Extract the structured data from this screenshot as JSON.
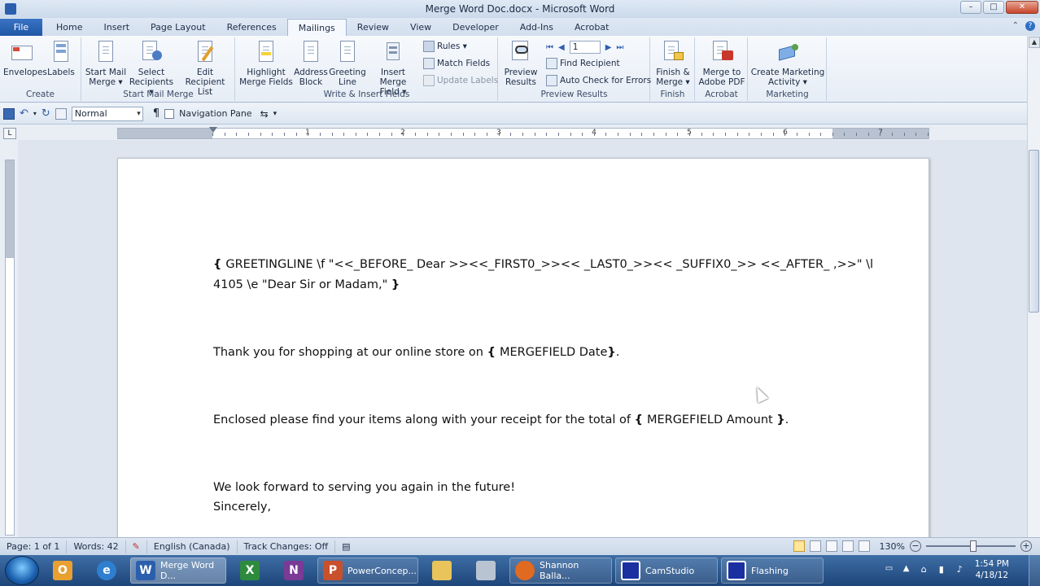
{
  "window": {
    "title": "Merge Word Doc.docx - Microsoft Word",
    "controls": {
      "minimize": "–",
      "maximize": "□",
      "close": "✕"
    }
  },
  "tabs": [
    {
      "label": "File",
      "active": false
    },
    {
      "label": "Home",
      "active": false
    },
    {
      "label": "Insert",
      "active": false
    },
    {
      "label": "Page Layout",
      "active": false
    },
    {
      "label": "References",
      "active": false
    },
    {
      "label": "Mailings",
      "active": true
    },
    {
      "label": "Review",
      "active": false
    },
    {
      "label": "View",
      "active": false
    },
    {
      "label": "Developer",
      "active": false
    },
    {
      "label": "Add-Ins",
      "active": false
    },
    {
      "label": "Acrobat",
      "active": false
    }
  ],
  "ribbon": {
    "create": {
      "label": "Create",
      "envelopes": "Envelopes",
      "labels": "Labels"
    },
    "start_mail_merge": {
      "label": "Start Mail Merge",
      "start_mail_merge_1": "Start Mail",
      "start_mail_merge_2": "Merge ▾",
      "select_recipients_1": "Select",
      "select_recipients_2": "Recipients ▾",
      "edit_recipient_list_1": "Edit",
      "edit_recipient_list_2": "Recipient List"
    },
    "write_insert": {
      "label": "Write & Insert Fields",
      "highlight_1": "Highlight",
      "highlight_2": "Merge Fields",
      "address_1": "Address",
      "address_2": "Block",
      "greeting_1": "Greeting",
      "greeting_2": "Line",
      "insert_merge_1": "Insert Merge",
      "insert_merge_2": "Field ▾",
      "rules": "Rules ▾",
      "match_fields": "Match Fields",
      "update_labels": "Update Labels"
    },
    "preview_results": {
      "label": "Preview Results",
      "preview_1": "Preview",
      "preview_2": "Results",
      "record_number": "1",
      "find_recipient": "Find Recipient",
      "auto_check": "Auto Check for Errors"
    },
    "finish": {
      "label": "Finish",
      "finish_1": "Finish &",
      "finish_2": "Merge ▾"
    },
    "acrobat": {
      "label": "Acrobat",
      "merge_pdf_1": "Merge to",
      "merge_pdf_2": "Adobe PDF"
    },
    "marketing": {
      "label": "Marketing",
      "create_1": "Create Marketing",
      "create_2": "Activity ▾"
    }
  },
  "qat": {
    "style": "Normal",
    "pilcrow": "¶",
    "navigation_pane": "Navigation Pane"
  },
  "ruler": {
    "corner": "L",
    "numbers": [
      "1",
      "2",
      "3",
      "4",
      "5",
      "6",
      "7"
    ]
  },
  "document": {
    "greeting_line_1a": "{ ",
    "greeting_line_1b": "GREETINGLINE \\f \"<<_BEFORE_ Dear >><<_FIRST0_>><< _LAST0_>><< _SUFFIX0_>> <<_AFTER_ ,>>\" \\l",
    "greeting_line_2a": "4105 \\e \"Dear Sir or Madam,\" ",
    "greeting_line_2b": "}",
    "thank_you_a": "Thank you for shopping at our online store on ",
    "thank_you_b": "{ ",
    "thank_you_c": "MERGEFIELD Date",
    "thank_you_d": "}",
    "thank_you_e": ".",
    "enclosed_a": "Enclosed please find your items along with your receipt for the total of ",
    "enclosed_b": "{ ",
    "enclosed_c": "MERGEFIELD Amount ",
    "enclosed_d": "}",
    "enclosed_e": ".",
    "forward": "We look forward to serving you again in the future!",
    "sincerely": "Sincerely,"
  },
  "status": {
    "page": "Page: 1 of 1",
    "words": "Words: 42",
    "language": "English (Canada)",
    "track_changes": "Track Changes: Off",
    "zoom": "130%",
    "zoom_out": "−",
    "zoom_in": "+"
  },
  "taskbar": {
    "items": [
      {
        "label": "Merge Word D...",
        "active": true
      },
      {
        "label": "PowerConcep...",
        "active": false
      },
      {
        "label": "Shannon Balla...",
        "active": false
      },
      {
        "label": "CamStudio",
        "active": false
      },
      {
        "label": "Flashing",
        "active": false
      }
    ],
    "time": "1:54 PM",
    "date": "4/18/12"
  }
}
